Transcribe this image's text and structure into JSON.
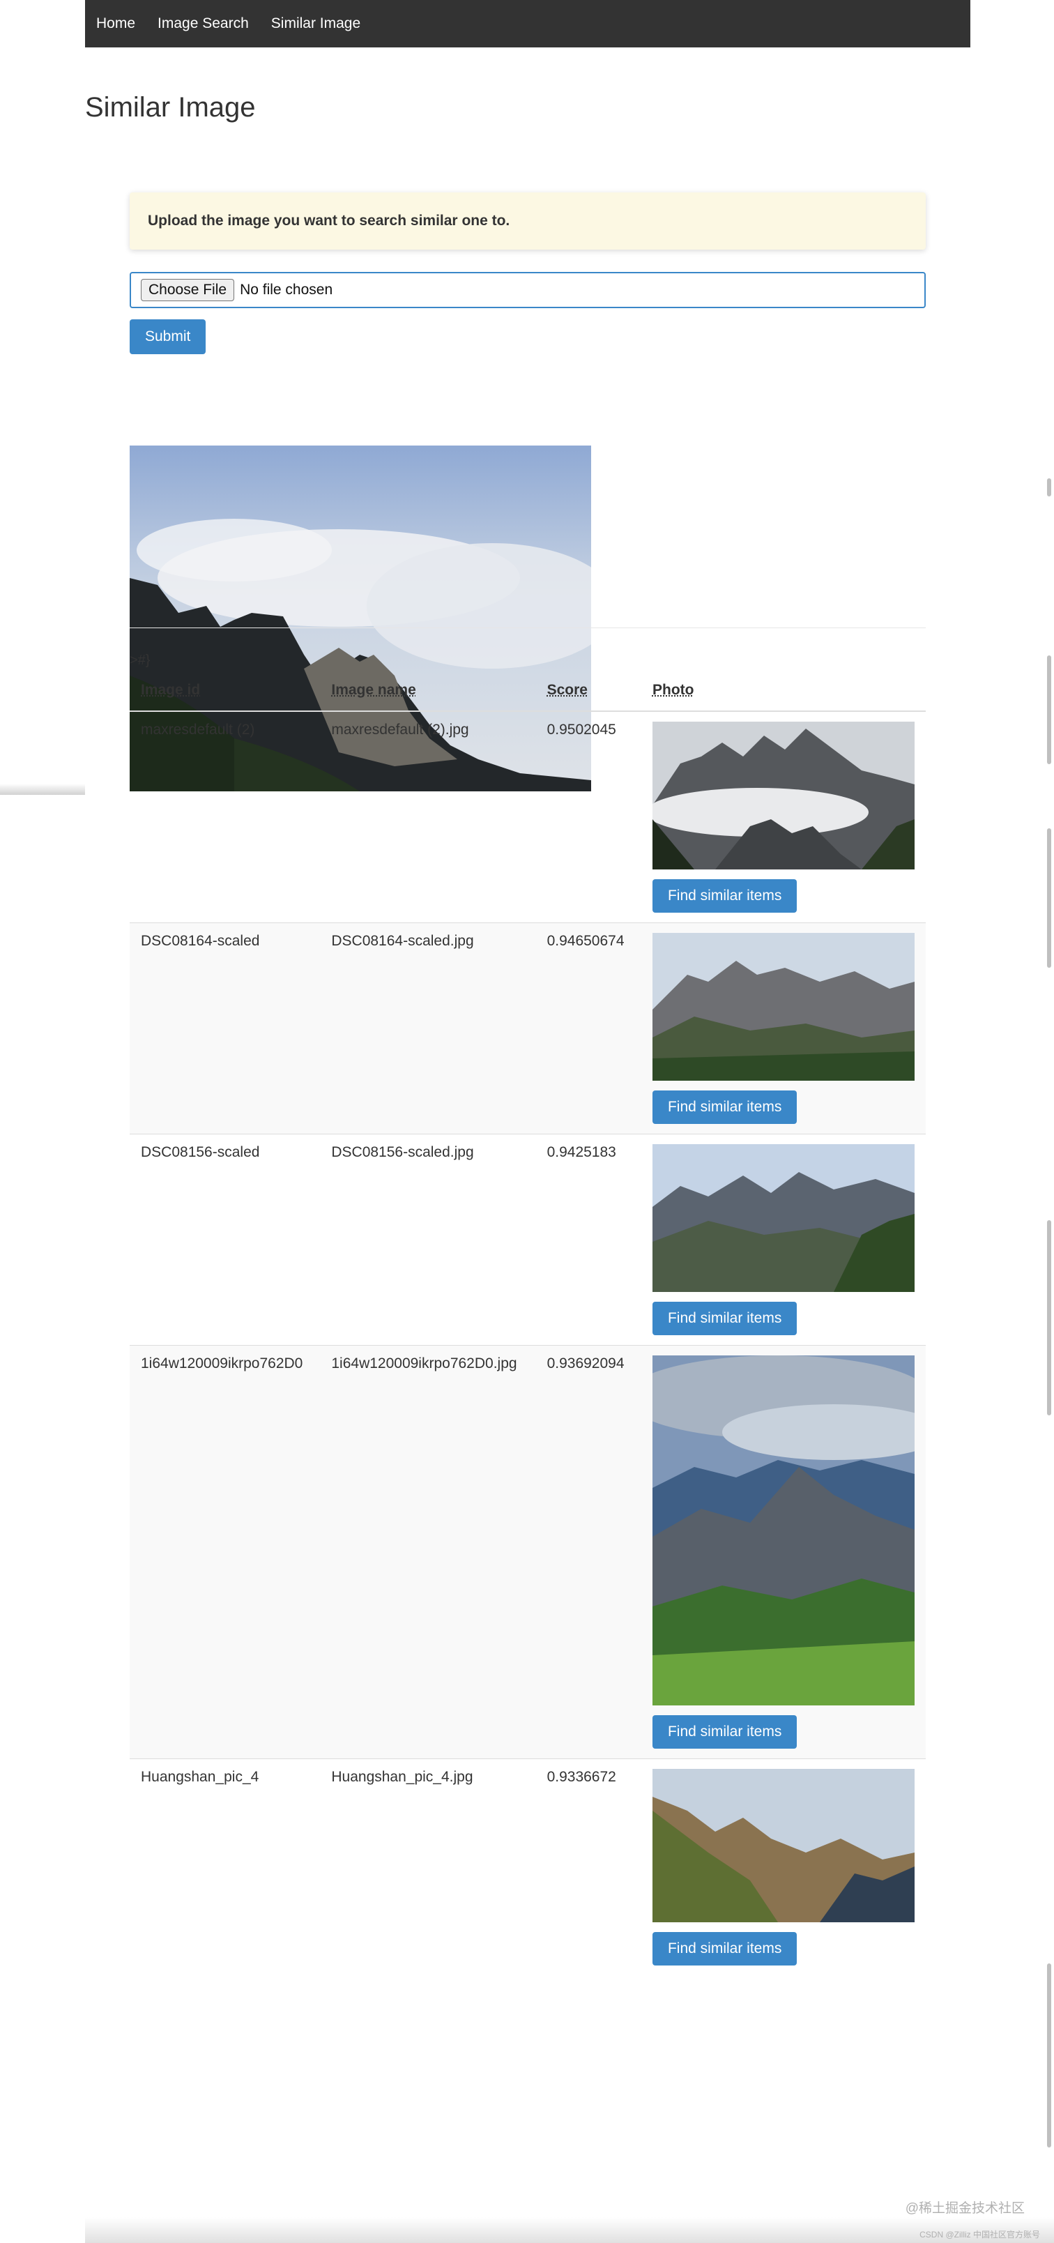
{
  "nav": {
    "items": [
      {
        "label": "Home"
      },
      {
        "label": "Image Search"
      },
      {
        "label": "Similar Image"
      }
    ]
  },
  "page": {
    "title": "Similar Image"
  },
  "upload": {
    "notice": "Upload the image you want to search similar one to.",
    "choose_label": "Choose File",
    "file_status": "No file chosen",
    "submit_label": "Submit"
  },
  "stray_text": ">#}",
  "table": {
    "headers": {
      "id": "Image id",
      "name": "Image name",
      "score": "Score",
      "photo": "Photo"
    },
    "rows": [
      {
        "id": "maxresdefault (2)",
        "name": "maxresdefault (2).jpg",
        "score": "0.9502045",
        "button": "Find similar items"
      },
      {
        "id": "DSC08164-scaled",
        "name": "DSC08164-scaled.jpg",
        "score": "0.94650674",
        "button": "Find similar items"
      },
      {
        "id": "DSC08156-scaled",
        "name": "DSC08156-scaled.jpg",
        "score": "0.9425183",
        "button": "Find similar items"
      },
      {
        "id": "1i64w120009ikrpo762D0",
        "name": "1i64w120009ikrpo762D0.jpg",
        "score": "0.93692094",
        "button": "Find similar items"
      },
      {
        "id": "Huangshan_pic_4",
        "name": "Huangshan_pic_4.jpg",
        "score": "0.9336672",
        "button": "Find similar items"
      }
    ]
  },
  "watermark": {
    "main": "@稀土掘金技术社区",
    "sub": "CSDN @Zilliz 中国社区官方账号"
  },
  "colors": {
    "navbar": "#333333",
    "primary_button": "#3a87c8",
    "notice_bg": "#fcf8e3"
  }
}
